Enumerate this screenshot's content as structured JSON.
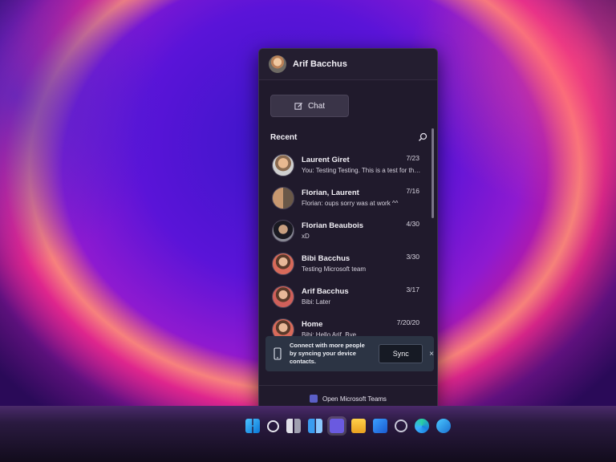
{
  "header": {
    "user_name": "Arif Bacchus"
  },
  "chat_button": {
    "label": "Chat"
  },
  "recent": {
    "label": "Recent"
  },
  "conversations": [
    {
      "name": "Laurent Giret",
      "preview": "You: Testing Testing. This is a test for the po...",
      "date": "7/23",
      "avatar_color": "#c89870"
    },
    {
      "name": "Florian, Laurent",
      "preview": "Florian: oups sorry was at work ^^",
      "date": "7/16",
      "avatar_color": "#a88868"
    },
    {
      "name": "Florian Beaubois",
      "preview": "xD",
      "date": "4/30",
      "avatar_color": "#5a5a66"
    },
    {
      "name": "Bibi Bacchus",
      "preview": "Testing Microsoft team",
      "date": "3/30",
      "avatar_color": "#d07060"
    },
    {
      "name": "Arif Bacchus",
      "preview": "Bibi: Later",
      "date": "3/17",
      "avatar_color": "#c86858"
    },
    {
      "name": "Home",
      "preview": "Bibi: Hello Arif.     Bye",
      "date": "7/20/20",
      "avatar_color": "#d06a5a"
    }
  ],
  "sync_banner": {
    "text": "Connect with more people by syncing your device contacts.",
    "button_label": "Sync",
    "close_symbol": "×"
  },
  "footer": {
    "label": "Open Microsoft Teams"
  },
  "taskbar": {
    "icons": [
      "windows-start-icon",
      "search-icon",
      "task-view-icon",
      "widgets-icon",
      "teams-chat-icon",
      "file-explorer-icon",
      "mail-icon",
      "settings-icon",
      "edge-icon",
      "store-icon"
    ]
  }
}
